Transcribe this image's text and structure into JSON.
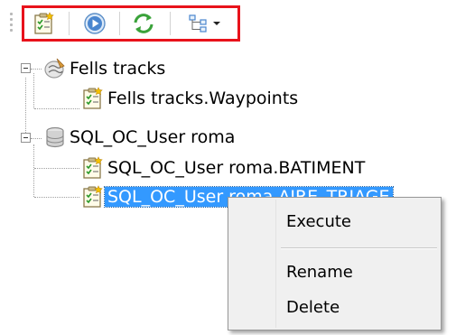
{
  "toolbar": {
    "buttons": [
      {
        "icon": "new-query-icon"
      },
      {
        "icon": "execute-icon"
      },
      {
        "icon": "refresh-icon"
      },
      {
        "icon": "tree-view-icon",
        "has_dropdown": true
      }
    ],
    "highlight_color": "#e8121b"
  },
  "tree": {
    "nodes": [
      {
        "label": "Fells tracks",
        "icon": "layer-source-icon",
        "expanded": true
      },
      {
        "label": "Fells tracks.Waypoints",
        "icon": "query-icon"
      },
      {
        "label": "SQL_OC_User roma",
        "icon": "database-icon",
        "expanded": true
      },
      {
        "label": "SQL_OC_User roma.BATIMENT",
        "icon": "query-icon"
      },
      {
        "label": "SQL_OC_User roma.AIRE_TRIAGE",
        "icon": "query-icon",
        "selected": true
      }
    ]
  },
  "context_menu": {
    "items": [
      {
        "label": "Execute"
      },
      {
        "label": "Rename"
      },
      {
        "label": "Delete"
      }
    ]
  },
  "colors": {
    "selection": "#3399ff",
    "menu_bg": "#f0f0f0"
  }
}
